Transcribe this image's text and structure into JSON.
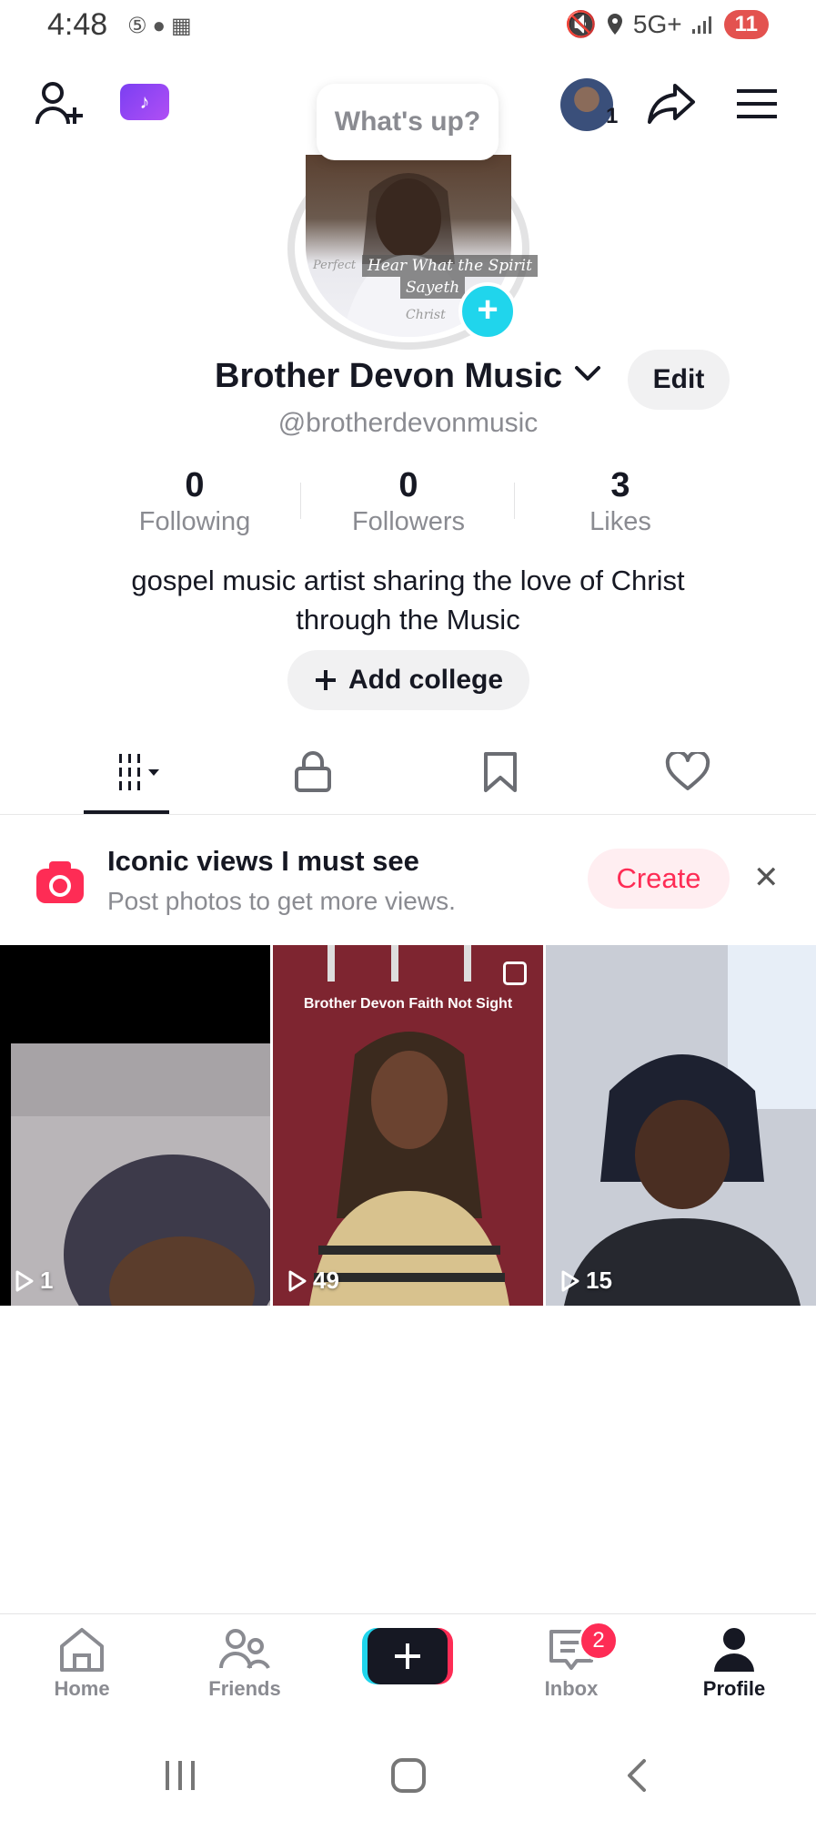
{
  "status_bar": {
    "time": "4:48",
    "network": "5G+",
    "battery": "11"
  },
  "top_bar": {
    "tooltip": "What's up?",
    "avatar_count": "1"
  },
  "profile": {
    "photo_text": {
      "line0": "Perfect",
      "line1": "Hear What the Spirit",
      "line2": "Sayeth",
      "line3": "Christ"
    },
    "display_name": "Brother Devon Music",
    "edit_label": "Edit",
    "username": "@brotherdevonmusic",
    "stats": [
      {
        "value": "0",
        "label": "Following"
      },
      {
        "value": "0",
        "label": "Followers"
      },
      {
        "value": "3",
        "label": "Likes"
      }
    ],
    "bio_line1": "gospel music artist sharing the love of Christ",
    "bio_line2": "through the Music",
    "add_college_label": "Add college"
  },
  "promo": {
    "title": "Iconic views I must see",
    "subtitle": "Post photos to get more views.",
    "create_label": "Create"
  },
  "videos": [
    {
      "views": "1",
      "caption": ""
    },
    {
      "views": "49",
      "caption": "Brother Devon Faith Not Sight"
    },
    {
      "views": "15",
      "caption": ""
    }
  ],
  "bottom_nav": {
    "home": "Home",
    "friends": "Friends",
    "inbox": "Inbox",
    "inbox_badge": "2",
    "profile": "Profile"
  },
  "colors": {
    "accent": "#fe2c55",
    "cyan": "#20d5ec",
    "text": "#161823",
    "muted": "#8a8b91"
  }
}
